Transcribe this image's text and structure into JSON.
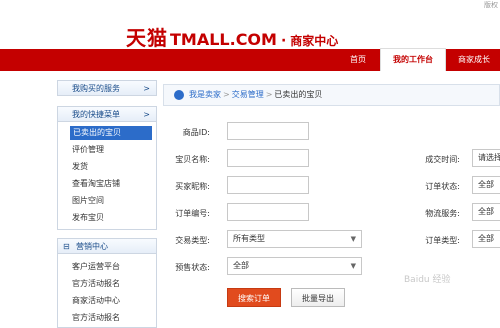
{
  "header": {
    "logo_cn": "天猫",
    "logo_en": "TMALL.COM",
    "logo_dot": "·",
    "logo_sub": "商家中心",
    "corner_text": "版权"
  },
  "nav": {
    "items": [
      "首页",
      "我的工作台",
      "商家成长"
    ],
    "active_index": 1
  },
  "sidebar": {
    "purchased_services": "我购买的服务",
    "purchased_arrow": ">",
    "quick_menu": "我的快捷菜单",
    "quick_arrow": ">",
    "quick_items": [
      "已卖出的宝贝",
      "评价管理",
      "发货",
      "查看淘宝店铺",
      "图片空间",
      "发布宝贝"
    ],
    "selected_index": 0,
    "marketing_title": "营销中心",
    "marketing_icon": "⊟",
    "marketing_items": [
      "客户运营平台",
      "官方活动报名",
      "商家活动中心",
      "官方活动报名"
    ]
  },
  "breadcrumb": {
    "items": [
      "我是卖家",
      "交易管理",
      "已卖出的宝贝"
    ],
    "separator": ">"
  },
  "form": {
    "product_id_label": "商品ID:",
    "product_name_label": "宝贝名称:",
    "buyer_nick_label": "买家昵称:",
    "order_no_label": "订单编号:",
    "trade_type_label": "交易类型:",
    "trade_type_value": "所有类型",
    "presale_label": "预售状态:",
    "presale_value": "全部",
    "deal_time_label": "成交时间:",
    "deal_time_placeholder": "请选择",
    "order_status_label": "订单状态:",
    "order_status_value": "全部",
    "logistics_label": "物流服务:",
    "logistics_value": "全部",
    "order_type_label": "订单类型:",
    "order_type_value": "全部",
    "caret": "▼"
  },
  "actions": {
    "search": "搜索订单",
    "export": "批量导出"
  },
  "watermark": "Baidu 经验"
}
